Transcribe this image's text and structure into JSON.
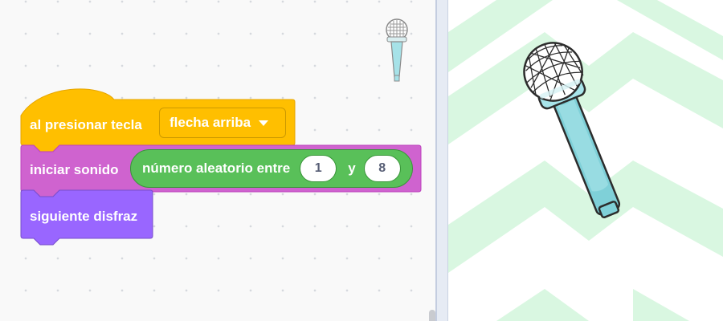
{
  "code_area": {
    "hat_block": {
      "label": "al presionar tecla",
      "dropdown_value": "flecha arriba",
      "color": "#ffbf00"
    },
    "sound_block": {
      "label": "iniciar sonido",
      "color": "#cf63cf",
      "reporter": {
        "label": "número aleatorio entre",
        "from": "1",
        "joiner": "y",
        "to": "8",
        "color": "#59c059"
      }
    },
    "looks_block": {
      "label": "siguiente disfraz",
      "color": "#9966ff"
    },
    "sprite_icon": "microphone-icon"
  },
  "stage": {
    "backdrop": "green-chevron-backdrop",
    "sprite": "microphone-icon",
    "colors": {
      "chevron": "#d9f7e1",
      "mic_handle": "#7fd0d8",
      "mic_head": "#ffffff"
    }
  }
}
